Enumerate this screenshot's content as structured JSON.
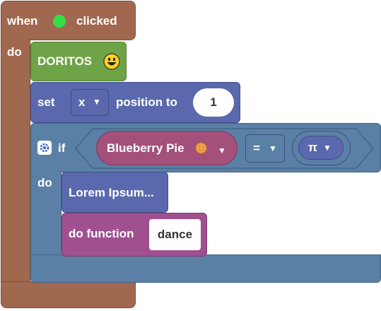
{
  "event": {
    "when": "when",
    "clicked": "clicked",
    "do": "do",
    "flag_color": "#33dd44"
  },
  "doritos": {
    "label": "DORITOS",
    "icon": "smiley-face-icon"
  },
  "set_block": {
    "set": "set",
    "var": "x",
    "position_to": "position to",
    "value": "1"
  },
  "if_block": {
    "if": "if",
    "do": "do",
    "variable": "Blueberry Pie",
    "variable_icon": "cookie-icon",
    "operator": "=",
    "constant": "π"
  },
  "lorem": {
    "label": "Lorem Ipsum..."
  },
  "do_function": {
    "label": "do function",
    "name": "dance"
  },
  "colors": {
    "event": "#a0694f",
    "doritos": "#6fa348",
    "motion": "#5a69ad",
    "control": "#5b80a5",
    "variable": "#a3507a",
    "function": "#a0508f"
  }
}
